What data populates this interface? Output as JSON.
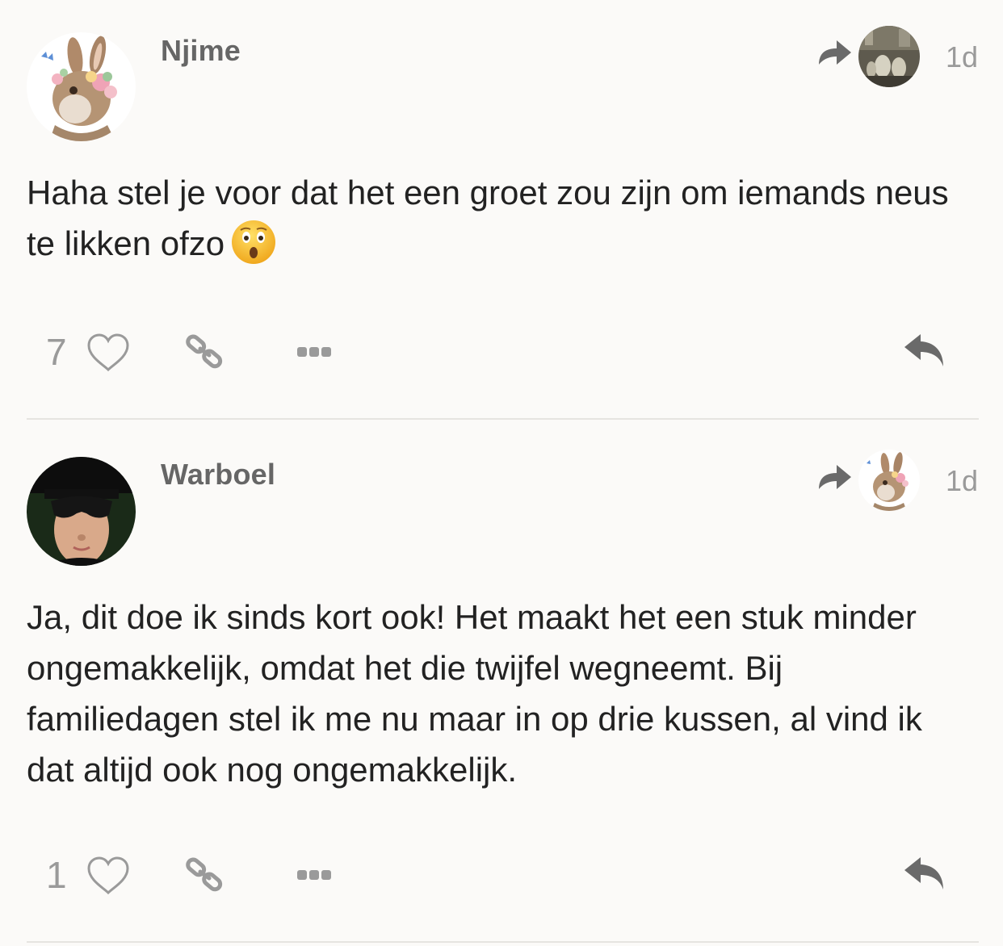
{
  "posts": [
    {
      "username": "Njime",
      "age": "1d",
      "text": "Haha stel je voor dat het een groet zou zijn om iemands neus te likken ofzo",
      "emoji": "astonished-face",
      "likes": "7",
      "avatar": "rabbit-watercolor-avatar",
      "reply_to_avatar": "painting-avatar"
    },
    {
      "username": "Warboel",
      "age": "1d",
      "text": "Ja, dit doe ik sinds kort ook! Het maakt het een stuk minder ongemakkelijk, omdat het die twijfel wegneemt. Bij familiedagen stel ik me nu maar in op drie kussen, al vind ik dat altijd ook nog ongemakkelijk.",
      "likes": "1",
      "avatar": "masked-person-avatar",
      "reply_to_avatar": "rabbit-watercolor-avatar"
    }
  ],
  "icons": {
    "heart": "heart-outline-icon",
    "link": "link-icon",
    "more": "more-dots-icon",
    "reply": "reply-icon",
    "reply_to": "share-arrow-icon"
  },
  "colors": {
    "background": "#fbfaf8",
    "username": "#666666",
    "muted": "#9a9a9a",
    "text": "#222222",
    "icon": "#6a6a6a"
  }
}
